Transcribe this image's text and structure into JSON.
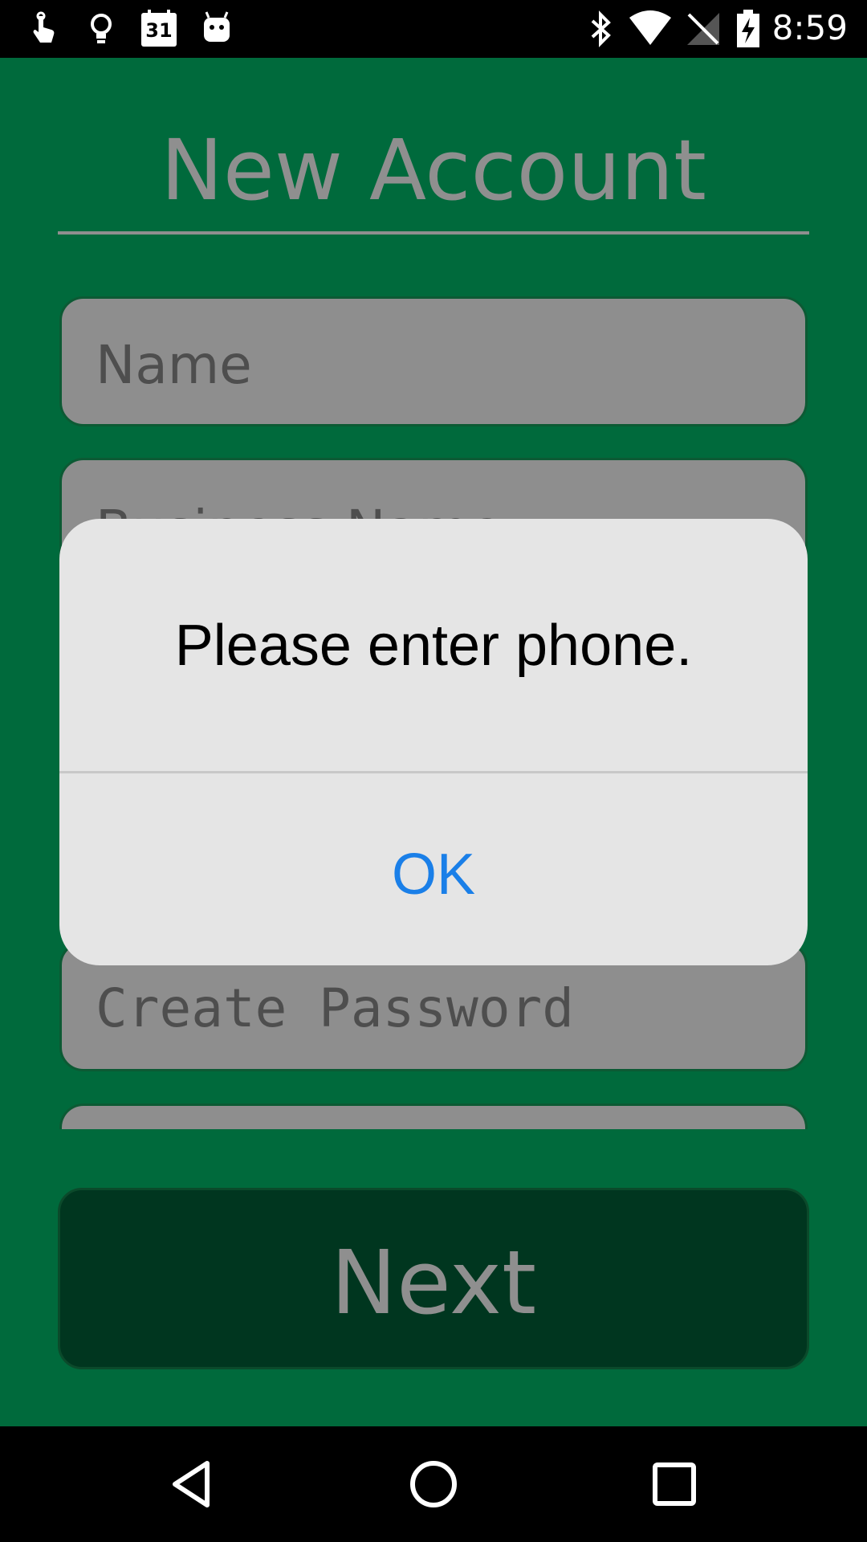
{
  "status_bar": {
    "time": "8:59",
    "calendar_day": "31",
    "icons": [
      "touch-icon",
      "lightbulb-icon",
      "calendar-icon",
      "android-icon",
      "bluetooth-icon",
      "wifi-icon",
      "no-signal-icon",
      "battery-charging-icon"
    ]
  },
  "screen": {
    "title": "New Account",
    "fields": {
      "name_placeholder": "Name",
      "business_name_placeholder": "Business Name",
      "create_password_placeholder": "Create Password"
    },
    "next_label": "Next"
  },
  "dialog": {
    "message": "Please enter phone.",
    "ok_label": "OK"
  },
  "nav_bar": {
    "icons": [
      "back-icon",
      "home-icon",
      "recents-icon"
    ]
  },
  "colors": {
    "background": "#006a3c",
    "field": "#8e8e8e",
    "next_button": "#00361f",
    "dialog": "#e5e5e5",
    "ok_text": "#1a7fe8"
  }
}
